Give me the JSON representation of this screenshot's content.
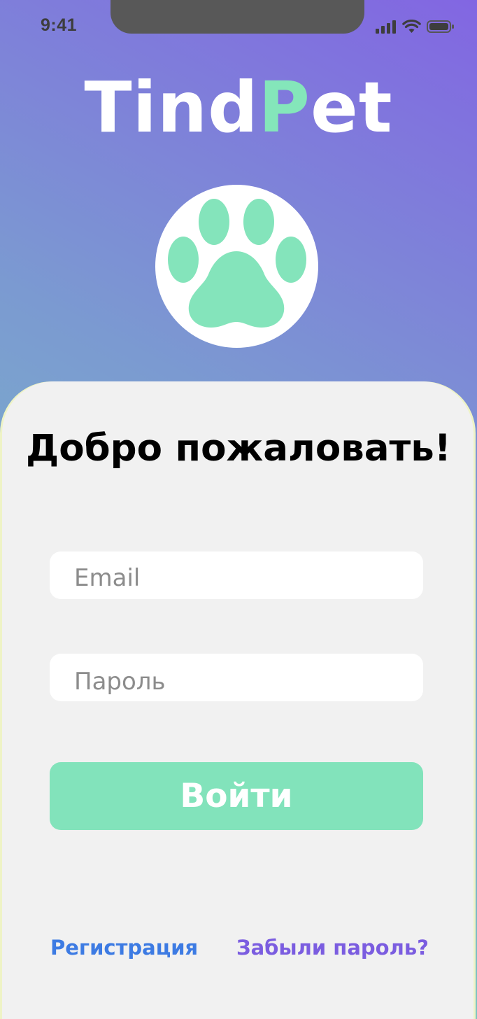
{
  "status_bar": {
    "time": "9:41",
    "icons": [
      "cellular-signal-icon",
      "wifi-icon",
      "battery-icon"
    ]
  },
  "logo": {
    "part1": "Tind",
    "accent": "P",
    "part2": "et",
    "icon": "paw-icon"
  },
  "login": {
    "title": "Добро пожаловать!",
    "email_placeholder": "Email",
    "password_placeholder": "Пароль",
    "submit_label": "Войти",
    "register_link": "Регистрация",
    "forgot_link": "Забыли пароль?"
  },
  "colors": {
    "accent_green": "#84e6ba",
    "link_blue": "#3d7be3",
    "link_purple": "#7b5de0",
    "sheet_background": "#f1f1f1"
  }
}
